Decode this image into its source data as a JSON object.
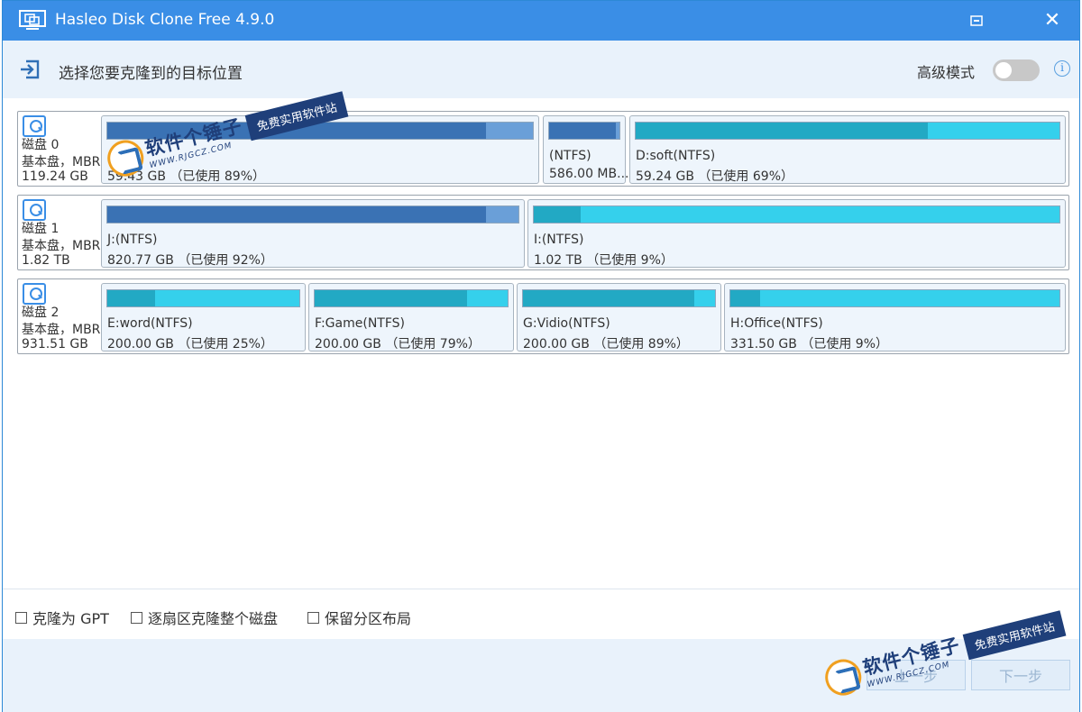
{
  "window": {
    "title": "Hasleo Disk Clone Free 4.9.0"
  },
  "header": {
    "title": "选择您要克隆到的目标位置",
    "mode_label": "高级模式",
    "info_symbol": "i"
  },
  "disks": [
    {
      "line1": "磁盘 0",
      "line2": "基本盘，MBR",
      "line3": "119.24 GB",
      "partitions": [
        {
          "name": "",
          "size": "59.43 GB （已使用 89%）",
          "used_percent": 89,
          "kind": "sys"
        },
        {
          "name": "(NTFS)",
          "size": "586.00 MB...",
          "used_percent": 95,
          "kind": "sys"
        },
        {
          "name": "D:soft(NTFS)",
          "size": "59.24 GB （已使用 69%）",
          "used_percent": 69,
          "kind": "data"
        }
      ]
    },
    {
      "line1": "磁盘 1",
      "line2": "基本盘，MBR",
      "line3": "1.82 TB",
      "partitions": [
        {
          "name": "J:(NTFS)",
          "size": "820.77 GB （已使用 92%）",
          "used_percent": 92,
          "kind": "sys"
        },
        {
          "name": "I:(NTFS)",
          "size": "1.02 TB （已使用 9%）",
          "used_percent": 9,
          "kind": "data"
        }
      ]
    },
    {
      "line1": "磁盘 2",
      "line2": "基本盘，MBR",
      "line3": "931.51 GB",
      "partitions": [
        {
          "name": "E:word(NTFS)",
          "size": "200.00 GB （已使用 25%）",
          "used_percent": 25,
          "kind": "data"
        },
        {
          "name": "F:Game(NTFS)",
          "size": "200.00 GB （已使用 79%）",
          "used_percent": 79,
          "kind": "data"
        },
        {
          "name": "G:Vidio(NTFS)",
          "size": "200.00 GB （已使用 89%）",
          "used_percent": 89,
          "kind": "data"
        },
        {
          "name": "H:Office(NTFS)",
          "size": "331.50 GB （已使用 9%）",
          "used_percent": 9,
          "kind": "data"
        }
      ]
    }
  ],
  "options": {
    "clone_gpt": "克隆为 GPT",
    "sector_clone": "逐扇区克隆整个磁盘",
    "keep_layout": "保留分区布局"
  },
  "footer": {
    "prev_label": "上一步",
    "next_label": "下一步"
  },
  "watermark": {
    "cn": "软件个锤子",
    "url": "WWW.RJGCZ.COM",
    "tag": "免费实用软件站"
  },
  "colors": {
    "titlebar": "#3a8ee6",
    "header_bg": "#e9f2fb",
    "sys_used": "#3a72b4",
    "data_used": "#22a9c4",
    "data_free": "#35d0ec"
  }
}
